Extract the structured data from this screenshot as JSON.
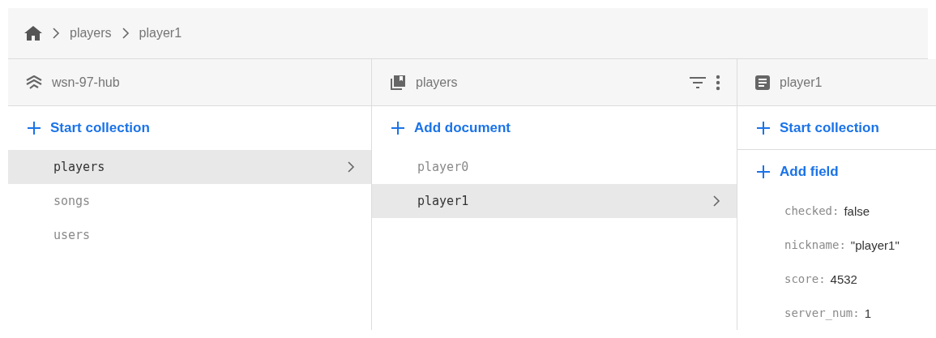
{
  "breadcrumb": [
    "players",
    "player1"
  ],
  "columns": [
    {
      "kind": "root",
      "title": "wsn-97-hub",
      "action": "Start collection",
      "items": [
        {
          "label": "players",
          "selected": true
        },
        {
          "label": "songs",
          "selected": false
        },
        {
          "label": "users",
          "selected": false
        }
      ]
    },
    {
      "kind": "collection",
      "title": "players",
      "action": "Add document",
      "items": [
        {
          "label": "player0",
          "selected": false
        },
        {
          "label": "player1",
          "selected": true
        }
      ]
    },
    {
      "kind": "document",
      "title": "player1",
      "action": "Start collection",
      "field_action": "Add field",
      "fields": [
        {
          "key": "checked:",
          "value": "false"
        },
        {
          "key": "nickname:",
          "value": "\"player1\""
        },
        {
          "key": "score:",
          "value": "4532"
        },
        {
          "key": "server_num:",
          "value": "1"
        }
      ]
    }
  ]
}
